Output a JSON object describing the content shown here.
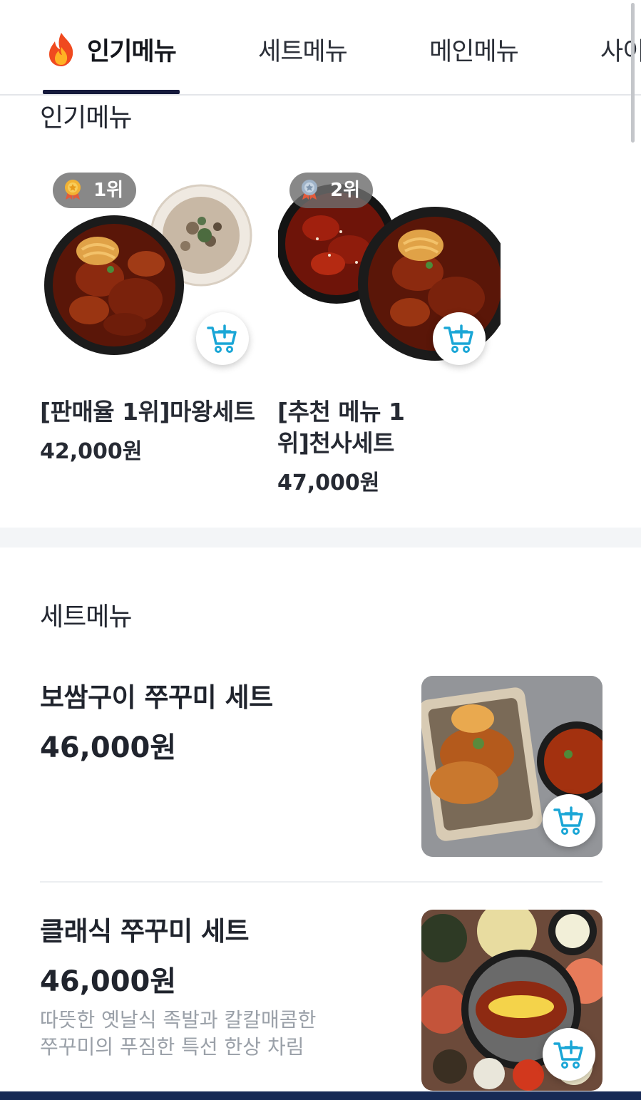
{
  "tabs": [
    {
      "label": "인기메뉴",
      "active": true,
      "icon": "flame-icon"
    },
    {
      "label": "세트메뉴",
      "active": false
    },
    {
      "label": "메인메뉴",
      "active": false
    },
    {
      "label": "사이",
      "active": false
    }
  ],
  "popular": {
    "title": "인기메뉴",
    "items": [
      {
        "rank": "1위",
        "medal": "gold-medal-icon",
        "name_line1": "[판매율 1위]마왕세트",
        "name_line2": "",
        "price": "42,000원"
      },
      {
        "rank": "2위",
        "medal": "silver-medal-icon",
        "name_line1": "[추천 메뉴 1",
        "name_line2": "위]천사세트",
        "price": "47,000원"
      }
    ]
  },
  "sets": {
    "title": "세트메뉴",
    "items": [
      {
        "name": "보쌈구이 쭈꾸미 세트",
        "price": "46,000원",
        "desc_line1": "",
        "desc_line2": ""
      },
      {
        "name": "클래식 쭈꾸미 세트",
        "price": "46,000원",
        "desc_line1": "따뜻한 옛날식 족발과 칼칼매콤한",
        "desc_line2": "쭈꾸미의 푸짐한 특선 한상 차림"
      }
    ]
  },
  "colors": {
    "accent": "#161a3c",
    "cart_icon": "#1aa6d6",
    "bottom_bar": "#172a55"
  }
}
